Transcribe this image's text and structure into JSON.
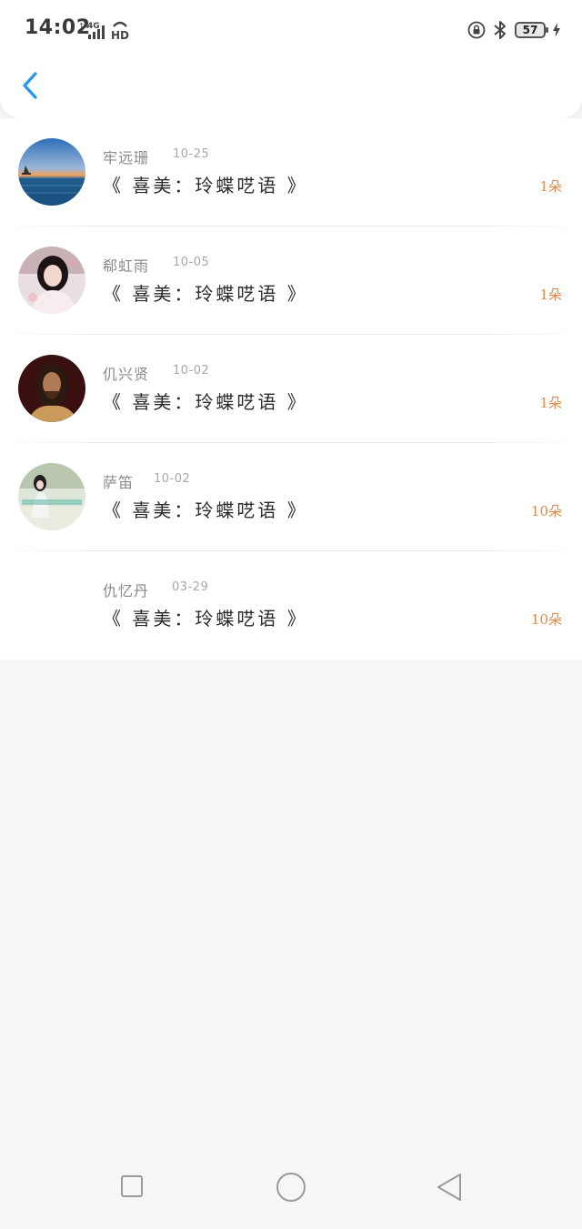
{
  "status_bar": {
    "time": "14:02",
    "network": "4G",
    "hd": "HD",
    "battery": "57"
  },
  "colors": {
    "accent_blue": "#2196f3",
    "count_orange": "#e0894a",
    "background": "#f7f5f6"
  },
  "header": {
    "back_icon": "chevron-left-icon"
  },
  "list": [
    {
      "name": "牢远珊",
      "date": "10-25",
      "title": "《 喜美：玲蝶呓语 》",
      "count": "1朵",
      "avatar": "sunset-sea"
    },
    {
      "name": "郗虹雨",
      "date": "10-05",
      "title": "《 喜美：玲蝶呓语 》",
      "count": "1朵",
      "avatar": "woman-portrait"
    },
    {
      "name": "仉兴贤",
      "date": "10-02",
      "title": "《 喜美：玲蝶呓语 》",
      "count": "1朵",
      "avatar": "bearded-man-portrait"
    },
    {
      "name": "萨笛",
      "date": "10-02",
      "title": "《 喜美：玲蝶呓语 》",
      "count": "10朵",
      "avatar": "girl-outdoor"
    },
    {
      "name": "仇忆丹",
      "date": "03-29",
      "title": "《 喜美：玲蝶呓语 》",
      "count": "10朵",
      "avatar": "none"
    }
  ],
  "nav_bar": {
    "recent_icon": "square-icon",
    "home_icon": "circle-icon",
    "back_icon": "triangle-back-icon"
  }
}
